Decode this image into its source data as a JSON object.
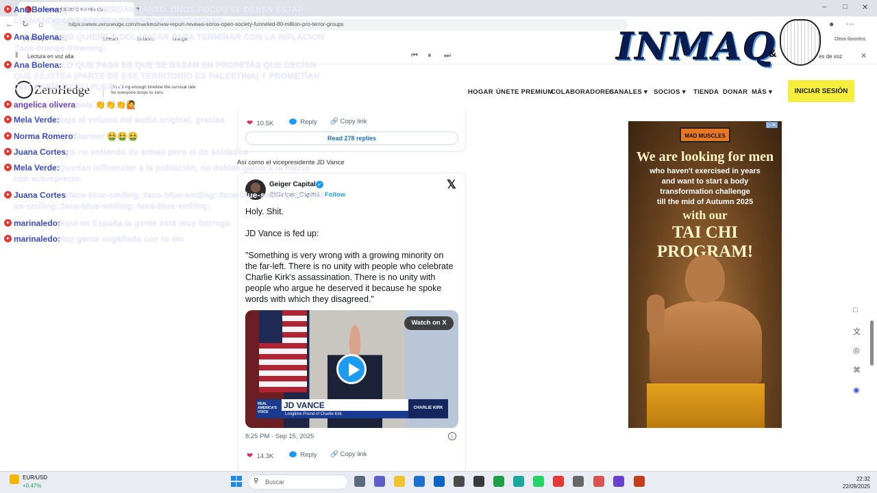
{
  "browser": {
    "tab_title": "Un nuevo informe revela qu...",
    "url": "https://www.zerohedge.com/markets/new-report-reveals-soros-open-society-funneled-80-million-pro-terror-groups",
    "bookmarks": [
      "(4) inmaq tv · YouT...",
      "Stream",
      "Enlaces",
      "Google"
    ],
    "other_bookmarks": "Otros favoritos",
    "read_aloud": "Lectura en voz alta",
    "voice_options": "es de voz"
  },
  "site": {
    "brand": "ZeroHedge",
    "tagline": "On a long enough timeline the survival rate for everyone drops to zero.",
    "nav": [
      "HOGAR",
      "ÚNETE PREMIUM",
      "COLABORADORES",
      "CANALES",
      "SOCIOS",
      "TIENDA",
      "DONAR",
      "MÁS"
    ],
    "login": "INICIAR SESIÓN"
  },
  "overlay_logo": {
    "text": "INMAQ",
    "amp": "&"
  },
  "chat": [
    {
      "author": "Ana Bolena:",
      "color": "#3b4bc4",
      "text": "QUE NO PIERDAN TANTO..UNOS POCOS SE DEBEN ESTAR LLENANDO LOS BOLSILLOS PERO EXPECTATIVAS"
    },
    {
      "author": "Ana Bolena:",
      "color": "#3b4bc4",
      "text": "NO QUIERE A DOLARIZAR PARA TERMINAR CON LA INFLACION :face-orange-frowning:"
    },
    {
      "author": "Ana Bolena:",
      "color": "#3b4bc4",
      "text": "LO QUE PASA ES QUE SE BASAN EN PROFETAS QUE DECÍAN QUE FILISTEA (PARTE DE ESE TERRITORIO ES PALESTINA) Y PROMETÍAN QUE SERÍA DE SU PUEBLO"
    },
    {
      "author": "angelica olivera:",
      "color": "#6a3fc0",
      "text": "hola 👏👏👏🙋"
    },
    {
      "author": "Mela Verde:",
      "color": "#3b4bc4",
      "text": "baja el volume del audio original, gracias"
    },
    {
      "author": "Norma Romero:",
      "color": "#3b4bc4",
      "text": "Starmer 🤮🤮🤮"
    },
    {
      "author": "Juana Cortes:",
      "color": "#3b4bc4",
      "text": "yo no entiendo de armas pero sí de soldados"
    },
    {
      "author": "Mela Verde:",
      "color": "#3b4bc4",
      "text": "Querían influenciar a la población, no debían ganar a la fuerza con sobreprecio."
    },
    {
      "author": "Juana Cortes:",
      "color": "#3b4bc4",
      "text": ":face-blue-smiling::face-blue-smiling::face-blue-smiling::face-blue-smiling::face-blue-smiling::face-blue-smiling:"
    },
    {
      "author": "marinaledo:",
      "color": "#3b4bc4",
      "text": "Aquí en España la gente está muy borrega"
    },
    {
      "author": "marinaledo:",
      "color": "#3b4bc4",
      "text": "Hay gente engañada con tu mo"
    }
  ],
  "prev_tweet": {
    "likes": "10.5K",
    "reply": "Reply",
    "copy": "Copy link",
    "read_replies": "Read 278 replies"
  },
  "caption": "Así como el vicepresidente JD Vance",
  "tweet": {
    "name": "Geiger Capital",
    "handle": "@Geiger_Capital",
    "follow": "Follow",
    "line1": "Holy. Shit.",
    "line2": "JD Vance is fed up:",
    "quote": "\"Something is very wrong with a growing minority on the far-left. There is no unity with people who celebrate Charlie Kirk's assassination. There is no unity with people who argue he deserved it because he spoke words with which they disagreed.\"",
    "watch": "Watch on X",
    "lower_third_left": "REAL AMERICA'S VOICE",
    "lower_third_name": "JD VANCE",
    "lower_third_sub": "Longtime Friend of Charlie Kirk",
    "lower_third_right": "CHARLIE KIRK",
    "date": "8:25 PM · Sep 15, 2025",
    "likes": "14.3K",
    "reply": "Reply",
    "copy": "Copy link"
  },
  "ad": {
    "brand": "MAD MUSCLES",
    "headline": "We are looking for men",
    "lines": [
      "who haven't exercised in years",
      "and want to start a body",
      "transformation challenge",
      "till the mid of Autumn 2025"
    ],
    "with": "with our",
    "program": "TAI CHI PROGRAM!"
  },
  "taskbar": {
    "pair": "EUR/USD",
    "change": "+0,47%",
    "search": "Buscar",
    "time": "22:32",
    "date": "22/09/2025"
  }
}
